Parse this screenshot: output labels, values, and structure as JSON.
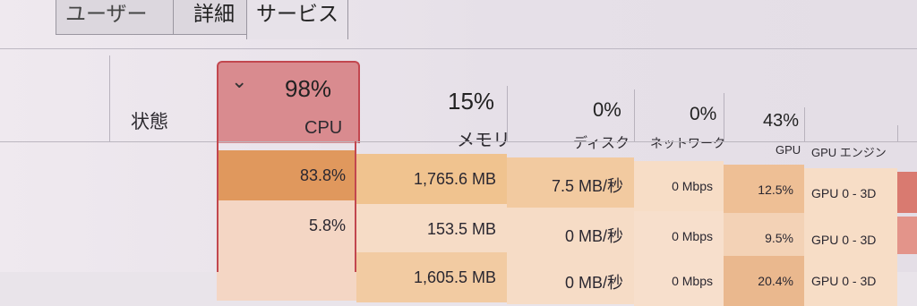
{
  "tabs": {
    "partial_label": "ユーザー",
    "details": "詳細",
    "services": "サービス"
  },
  "columns": {
    "status": "状態",
    "cpu": {
      "percent": "98%",
      "label": "CPU"
    },
    "memory": {
      "percent": "15%",
      "label": "メモリ"
    },
    "disk": {
      "percent": "0%",
      "label": "ディスク"
    },
    "network": {
      "percent": "0%",
      "label": "ネットワーク"
    },
    "gpu": {
      "percent": "43%",
      "label": "GPU"
    },
    "gpu_engine": {
      "label": "GPU エンジン"
    }
  },
  "rows": [
    {
      "cpu": "83.8%",
      "memory": "1,765.6 MB",
      "disk": "7.5 MB/秒",
      "network": "0 Mbps",
      "gpu": "12.5%",
      "gpu_engine": "GPU 0 - 3D"
    },
    {
      "cpu": "5.8%",
      "memory": "153.5 MB",
      "disk": "0 MB/秒",
      "network": "0 Mbps",
      "gpu": "9.5%",
      "gpu_engine": "GPU 0 - 3D"
    },
    {
      "cpu": "",
      "memory": "1,605.5 MB",
      "disk": "0 MB/秒",
      "network": "0 Mbps",
      "gpu": "20.4%",
      "gpu_engine": "GPU 0 - 3D"
    }
  ],
  "colors": {
    "cpu_header_bg": "#d98b8f",
    "cpu_header_border": "#c2474f",
    "heat_high": "#e3a064",
    "heat_mid": "#f0c9a0",
    "heat_low": "#f6dcc6"
  }
}
